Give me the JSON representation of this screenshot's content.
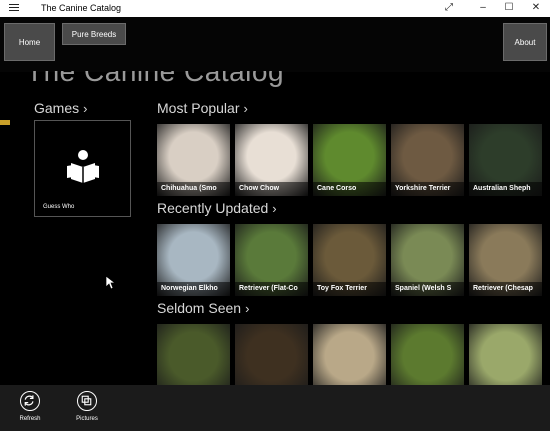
{
  "titlebar": {
    "app_name": "The Canine Catalog",
    "menu_icon": "hamburger-icon"
  },
  "nav": {
    "home": "Home",
    "pure_breeds": "Pure Breeds",
    "about": "About"
  },
  "header": {
    "title": "The Canine Catalog"
  },
  "games": {
    "title": "Games",
    "chevron": "›",
    "tile_label": "Guess Who",
    "icon": "reader-icon"
  },
  "sections": [
    {
      "title": "Most Popular",
      "chevron": "›",
      "items": [
        "Chihuahua (Smo",
        "Chow Chow",
        "Cane Corso",
        "Yorkshire Terrier",
        "Australian Sheph"
      ],
      "bg_colors": [
        "#d9cfc4",
        "#e8dfd5",
        "#5f8a2e",
        "#6e5a42",
        "#2d3d2a"
      ]
    },
    {
      "title": "Recently Updated",
      "chevron": "›",
      "items": [
        "Norwegian Elkho",
        "Retriever (Flat-Co",
        "Toy Fox Terrier",
        "Spaniel (Welsh S",
        "Retriever (Chesap"
      ],
      "bg_colors": [
        "#a8b7c2",
        "#5a7a3a",
        "#6b5a3a",
        "#7a8a55",
        "#8a7a5a"
      ]
    },
    {
      "title": "Seldom Seen",
      "chevron": "›",
      "items": [
        "",
        "",
        "",
        "",
        ""
      ],
      "bg_colors": [
        "#4a5a2a",
        "#3e3020",
        "#b9a888",
        "#5c7a2f",
        "#9aa86a"
      ]
    }
  ],
  "bottom_bar": {
    "refresh": "Refresh",
    "pictures": "Pictures"
  },
  "colors": {
    "accent": "#c9a02a",
    "nav_button": "#4a4a4a",
    "bottom_bar": "#1b1b1b"
  }
}
